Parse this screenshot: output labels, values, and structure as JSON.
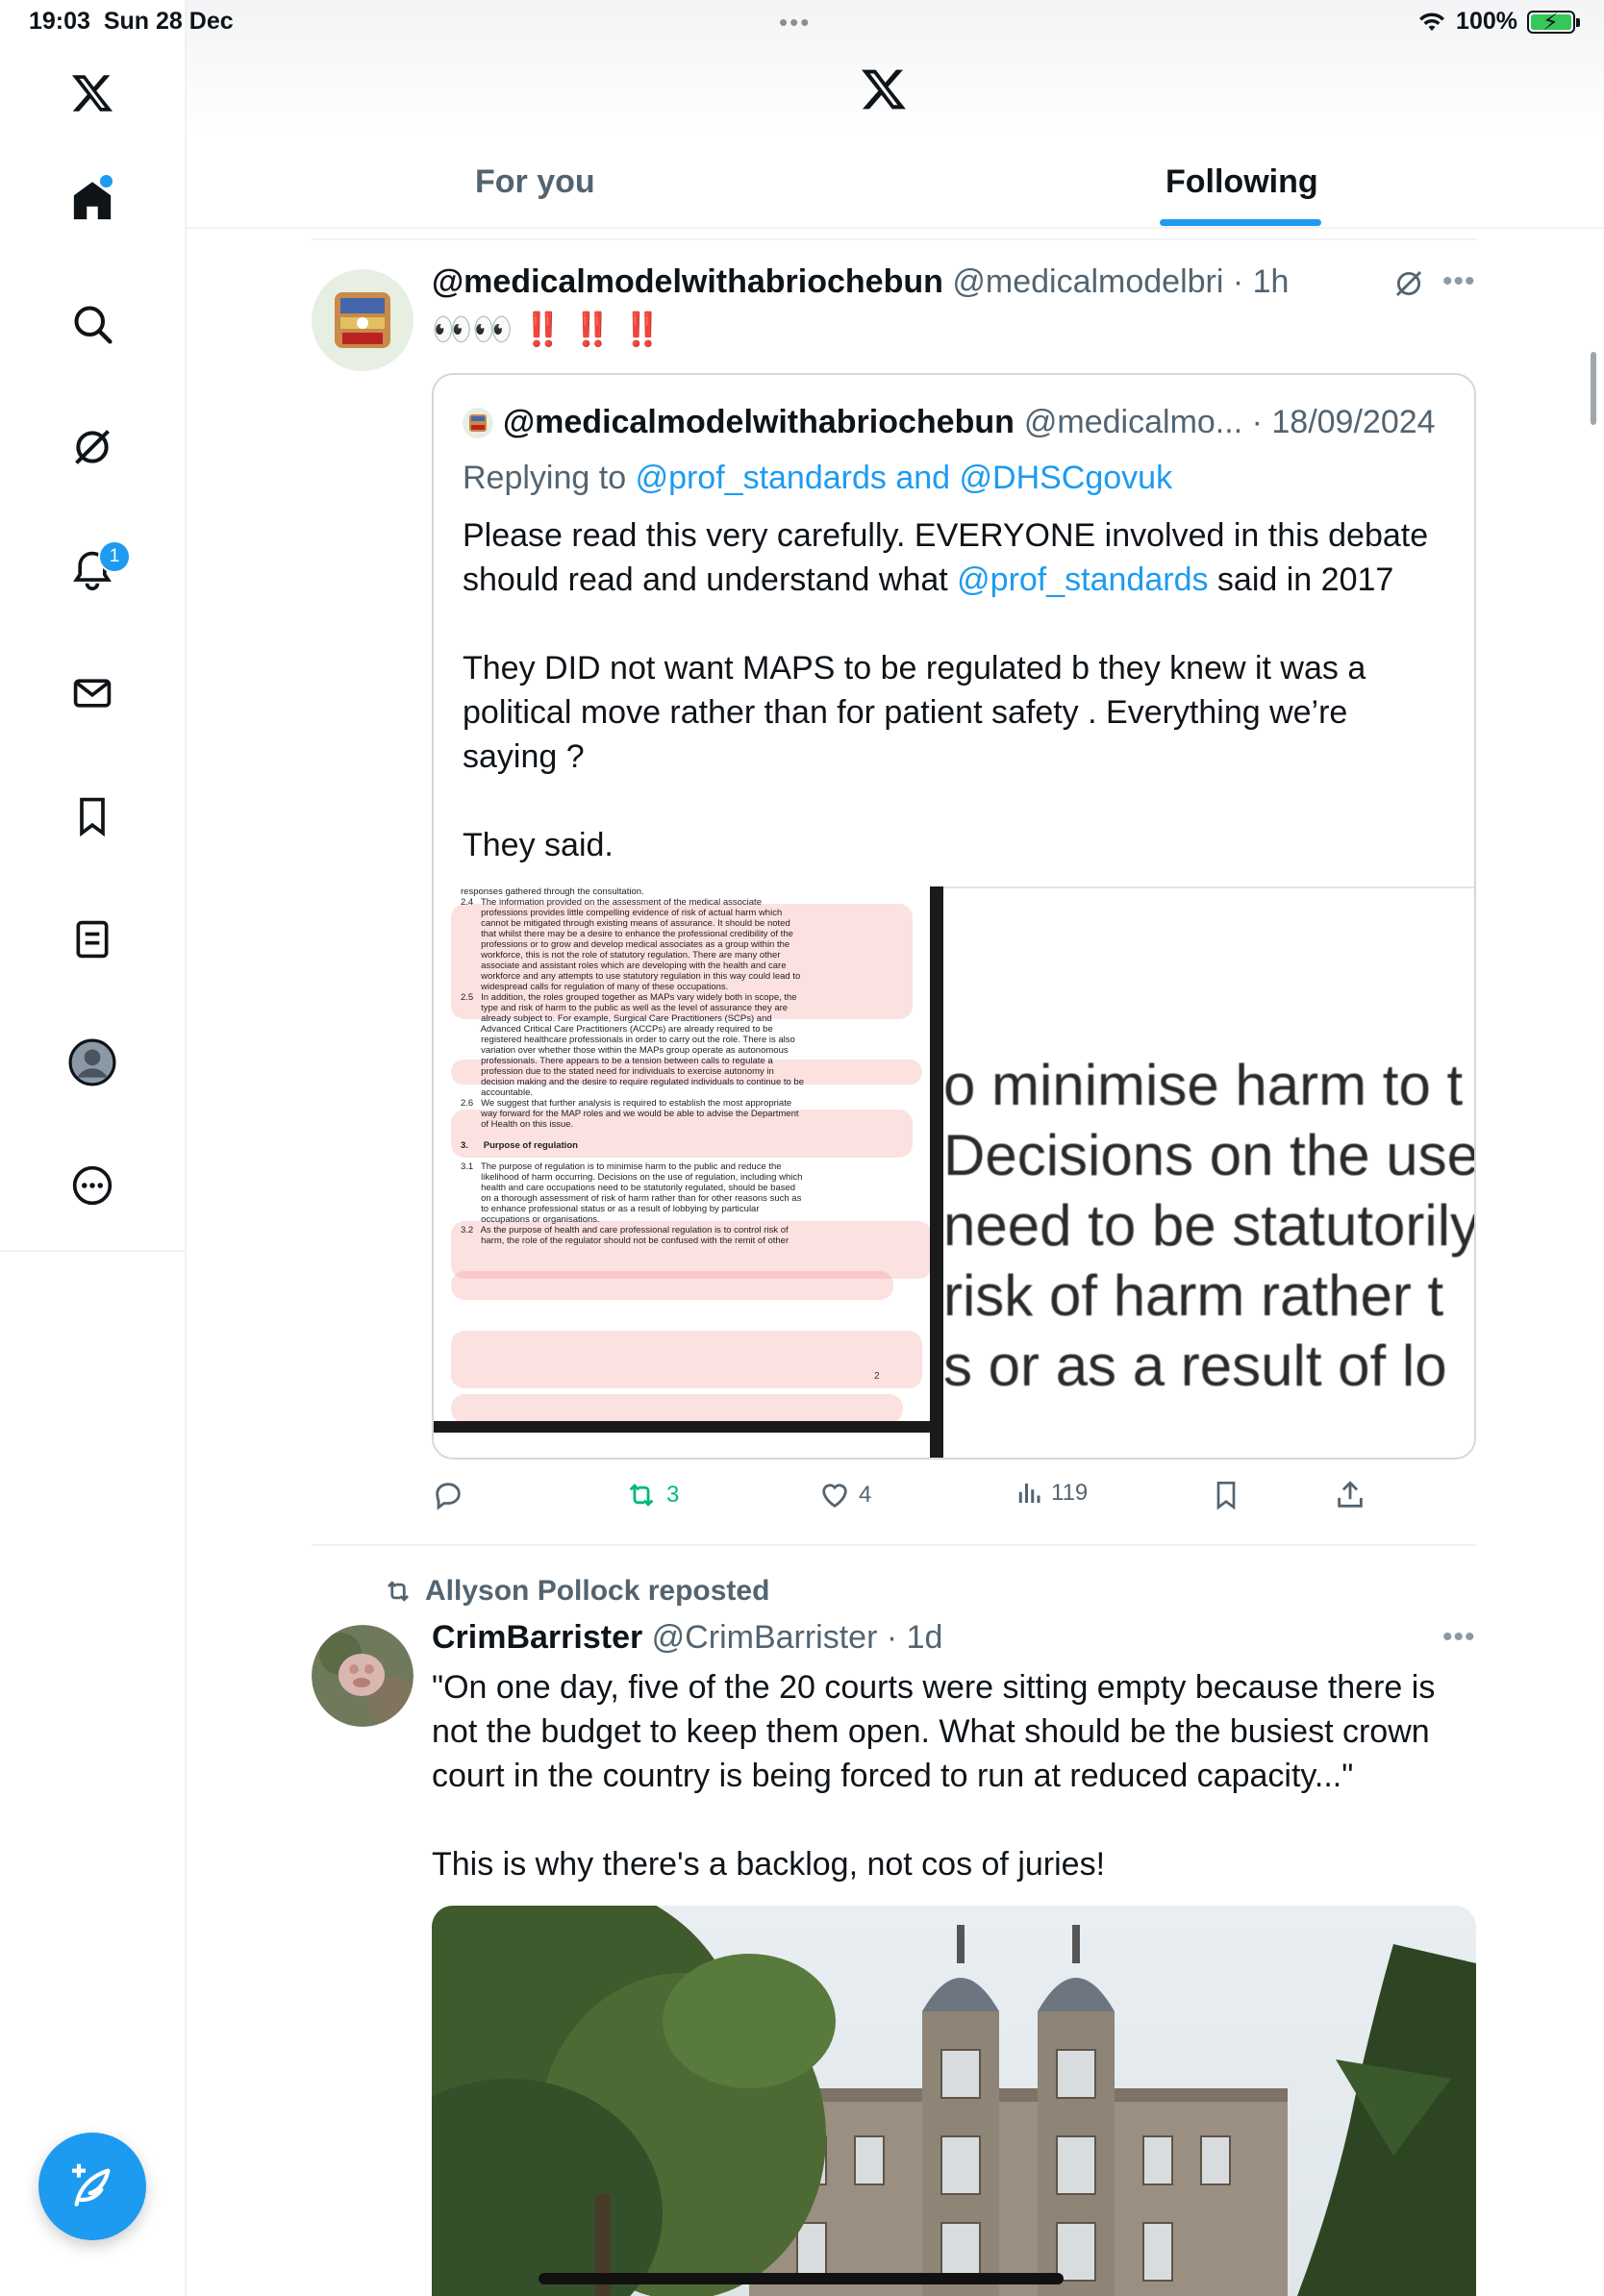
{
  "status_bar": {
    "time": "19:03",
    "date": "Sun 28 Dec",
    "battery": "100%"
  },
  "sidebar": {
    "items": [
      "home",
      "explore",
      "grok",
      "notifications",
      "messages",
      "bookmarks",
      "lists",
      "profile",
      "more"
    ],
    "notification_count": "1"
  },
  "header": {
    "tabs": [
      {
        "label": "For you",
        "active": false
      },
      {
        "label": "Following",
        "active": true
      }
    ]
  },
  "tweets": [
    {
      "display_name": "@medicalmodelwithabriochebun",
      "handle": "@medicalmodelbri",
      "time": "1h",
      "text": "👀👀 ‼️ ‼️ ‼️",
      "quote": {
        "display_name": "@medicalmodelwithabriochebun",
        "handle": "@medicalmo...",
        "date": "18/09/2024",
        "replying_prefix": "Replying to",
        "replying_to": "@prof_standards and @DHSCgovuk",
        "text_part1": "Please read this very carefully. EVERYONE involved in this debate should read and understand what ",
        "text_mention": "@prof_standards",
        "text_part2": " said in 2017\n\nThey DID not want MAPS to be regulated b they knew it was a political move rather than for patient safety . Everything we’re saying ?\n\nThey said.",
        "image_left_lines": [
          "responses gathered through the consultation.",
          "2.4   The information provided on the assessment of the medical associate",
          "        professions provides little compelling evidence of risk of actual harm which",
          "        cannot be mitigated through existing means of assurance. It should be noted",
          "        that whilst there may be a desire to enhance the professional credibility of the",
          "        professions or to grow and develop medical associates as a group within the",
          "        workforce, this is not the role of statutory regulation. There are many other",
          "        associate and assistant roles which are developing with the health and care",
          "        workforce and any attempts to use statutory regulation in this way could lead to",
          "        widespread calls for regulation of many of these occupations.",
          "2.5   In addition, the roles grouped together as MAPs vary widely both in scope, the",
          "        type and risk of harm to the public as well as the level of assurance they are",
          "        already subject to. For example, Surgical Care Practitioners (SCPs) and",
          "        Advanced Critical Care Practitioners (ACCPs) are already required to be",
          "        registered healthcare professionals in order to carry out the role. There is also",
          "        variation over whether those within the MAPs group operate as autonomous",
          "        professionals. There appears to be a tension between calls to regulate a",
          "        profession due to the stated need for individuals to exercise autonomy in",
          "        decision making and the desire to require regulated individuals to continue to be",
          "        accountable.",
          "2.6   We suggest that further analysis is required to establish the most appropriate",
          "        way forward for the MAP roles and we would be able to advise the Department",
          "        of Health on this issue.",
          "",
          "3.      Purpose of regulation",
          "",
          "3.1   The purpose of regulation is to minimise harm to the public and reduce the",
          "        likelihood of harm occurring. Decisions on the use of regulation, including which",
          "        health and care occupations need to be statutorily regulated, should be based",
          "        on a thorough assessment of risk of harm rather than for other reasons such as",
          "        to enhance professional status or as a result of lobbying by particular",
          "        occupations or organisations.",
          "3.2   As the purpose of health and care professional regulation is to control risk of",
          "        harm, the role of the regulator should not be confused with the remit of other"
        ],
        "image_left_page_number": "2",
        "image_right_lines": [
          "o minimise harm to t",
          "Decisions on the use",
          "need to be statutorily",
          "risk of harm rather t",
          "s or as a result of lo"
        ]
      },
      "actions": {
        "replies": "",
        "reposts": "3",
        "likes": "4",
        "views": "119"
      }
    },
    {
      "repost_label": "Allyson Pollock reposted",
      "display_name": "CrimBarrister",
      "handle": "@CrimBarrister",
      "time": "1d",
      "text": "\"On one day, five of the 20 courts were sitting empty because there is not the budget to keep them open. What should be the busiest crown court in the country is being forced to run at reduced capacity...\"\n\nThis is why there's a backlog, not cos of juries!"
    }
  ],
  "colors": {
    "accent": "#1d9bf0",
    "repost_green": "#00ba7c",
    "muted": "#536471",
    "text": "#0f1419",
    "like_red": "#f91880",
    "dots_red": "#e0245e"
  },
  "icons": [
    "x-logo-icon",
    "home-icon",
    "search-icon",
    "grok-icon",
    "bell-icon",
    "mail-icon",
    "bookmark-icon",
    "list-icon",
    "profile-icon",
    "more-circle-icon",
    "compose-icon",
    "reply-icon",
    "repost-icon",
    "like-icon",
    "views-icon",
    "share-icon",
    "more-dots-icon"
  ]
}
